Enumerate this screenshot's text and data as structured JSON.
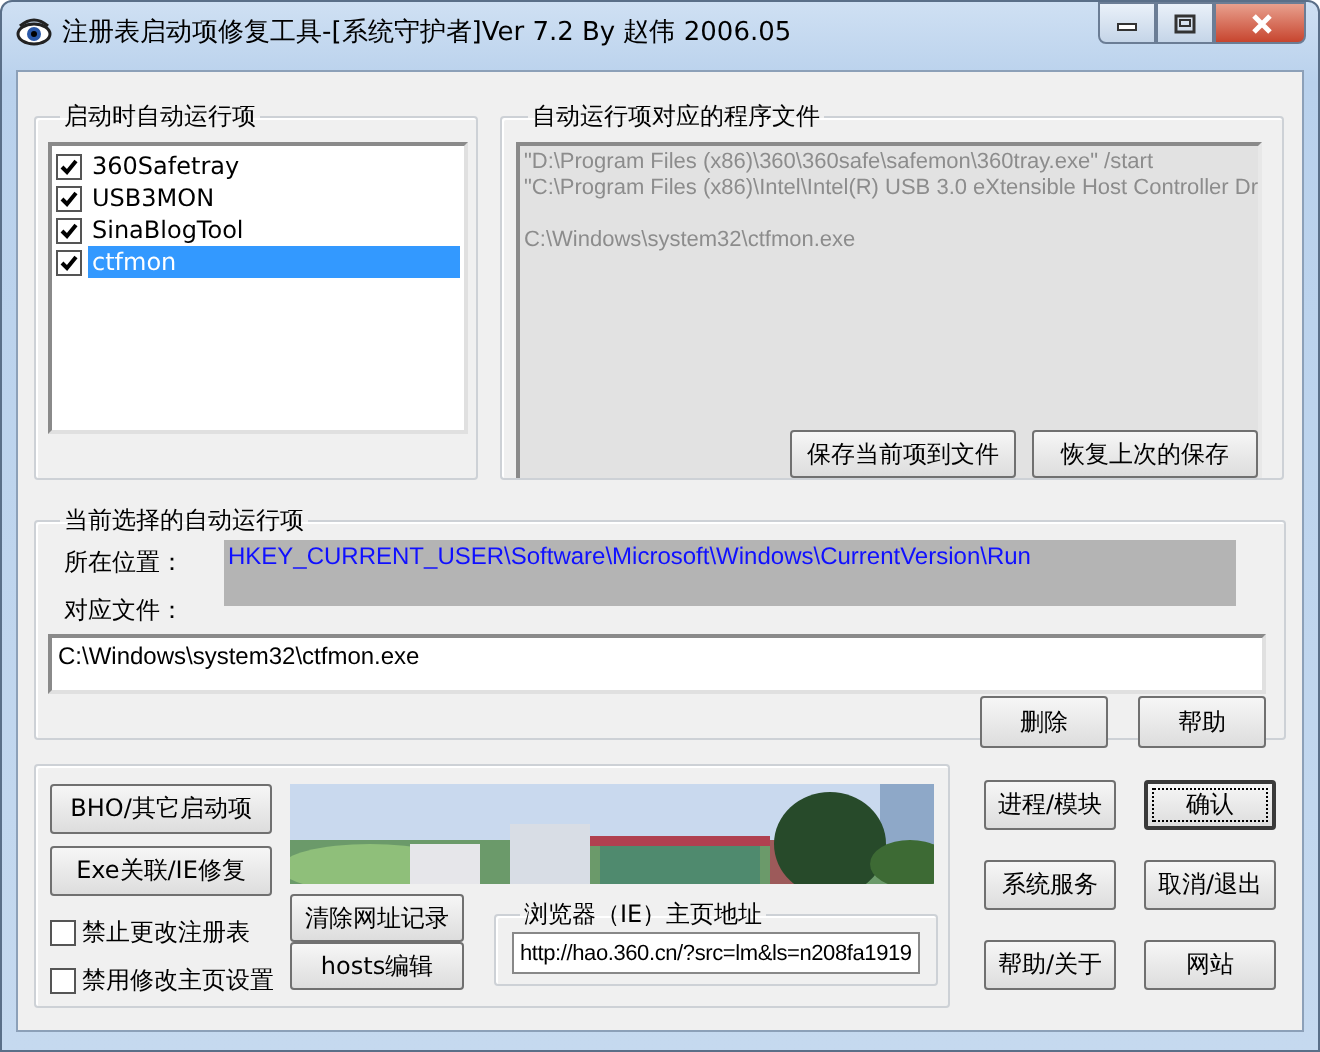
{
  "window": {
    "title": "注册表启动项修复工具-[系统守护者]Ver 7.2 By 赵伟 2006.05"
  },
  "startup_group": {
    "title": "启动时自动运行项",
    "items": [
      {
        "label": "360Safetray",
        "checked": true,
        "selected": false
      },
      {
        "label": "USB3MON",
        "checked": true,
        "selected": false
      },
      {
        "label": "SinaBlogTool",
        "checked": true,
        "selected": false
      },
      {
        "label": "ctfmon",
        "checked": true,
        "selected": true
      }
    ]
  },
  "files_group": {
    "title": "自动运行项对应的程序文件",
    "text": "\"D:\\Program Files (x86)\\360\\360safe\\safemon\\360tray.exe\" /start\n\"C:\\Program Files (x86)\\Intel\\Intel(R) USB 3.0 eXtensible Host Controller Dr\n\nC:\\Windows\\system32\\ctfmon.exe",
    "buttons": [
      "保存当前项到文件",
      "恢复上次的保存"
    ]
  },
  "current_group": {
    "title": "当前选择的自动运行项",
    "location_label": "所在位置：",
    "location": "HKEY_CURRENT_USER\\Software\\Microsoft\\Windows\\CurrentVersion\\Run",
    "file_label": "对应文件：",
    "file": "C:\\Windows\\system32\\ctfmon.exe",
    "buttons": [
      "删除",
      "帮助"
    ]
  },
  "tools_group": {
    "buttons": [
      "BHO/其它启动项",
      "Exe关联/IE修复"
    ],
    "checkboxes": [
      {
        "label": "禁止更改注册表",
        "checked": false
      },
      {
        "label": "禁用修改主页设置",
        "checked": false
      }
    ],
    "url_buttons": [
      "清除网址记录",
      "hosts编辑"
    ],
    "homepage": {
      "title": "浏览器（IE）主页地址",
      "value": "http://hao.360.cn/?src=lm&ls=n208fa1919"
    }
  },
  "actions": [
    {
      "label": "进程/模块",
      "focused": false
    },
    {
      "label": "确认",
      "focused": true
    },
    {
      "label": "系统服务",
      "focused": false
    },
    {
      "label": "取消/退出",
      "focused": false
    },
    {
      "label": "帮助/关于",
      "focused": false
    },
    {
      "label": "网站",
      "focused": false
    }
  ]
}
